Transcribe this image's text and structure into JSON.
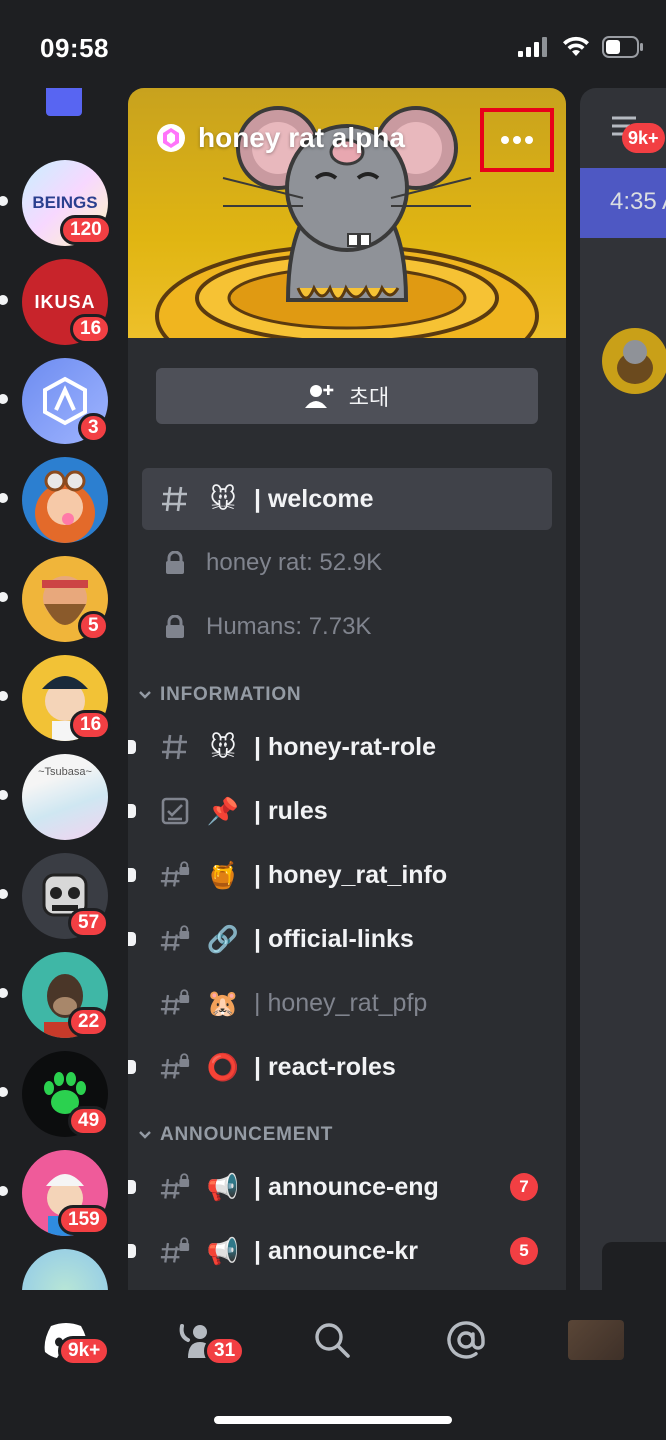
{
  "status_bar": {
    "time": "09:58"
  },
  "servers": [
    {
      "art_text": "BEINGS",
      "badge": "120"
    },
    {
      "art_text": "IKUSA",
      "badge": "16"
    },
    {
      "art_text": "",
      "badge": "3"
    },
    {
      "art_text": "",
      "badge": ""
    },
    {
      "art_text": "",
      "badge": "5"
    },
    {
      "art_text": "",
      "badge": "16"
    },
    {
      "art_text": "~Tsubasa~",
      "badge": ""
    },
    {
      "art_text": "",
      "badge": "57"
    },
    {
      "art_text": "",
      "badge": "22"
    },
    {
      "art_text": "",
      "badge": "49"
    },
    {
      "art_text": "",
      "badge": "159"
    }
  ],
  "server_panel": {
    "name": "honey rat alpha",
    "invite_label": "초대",
    "channels_top": [
      {
        "name": "| welcome",
        "emoji": "🐭"
      },
      {
        "name": "honey rat: 52.9K"
      },
      {
        "name": "Humans: 7.73K"
      }
    ],
    "categories": [
      {
        "label": "INFORMATION",
        "channels": [
          {
            "name": "| honey-rat-role",
            "emoji": "🐭"
          },
          {
            "name": "| rules",
            "emoji": "📌"
          },
          {
            "name": "| honey_rat_info",
            "emoji": "🍯"
          },
          {
            "name": "| official-links",
            "emoji": "🔗"
          },
          {
            "name": "| honey_rat_pfp",
            "emoji": "🐹"
          },
          {
            "name": "| react-roles",
            "emoji": "⭕"
          }
        ]
      },
      {
        "label": "ANNOUNCEMENT",
        "channels": [
          {
            "name": "| announce-eng",
            "emoji": "📢",
            "badge": "7"
          },
          {
            "name": "| announce-kr",
            "emoji": "📢",
            "badge": "5"
          }
        ]
      }
    ]
  },
  "right_peek": {
    "badge": "9k+",
    "time": "4:35 A"
  },
  "bottom_nav": {
    "home_badge": "9k+",
    "friends_badge": "31"
  },
  "colors": {
    "accent": "#5865f2",
    "badge": "#f23f43",
    "highlight_box": "#e8001a",
    "banner": "#e0b512"
  }
}
